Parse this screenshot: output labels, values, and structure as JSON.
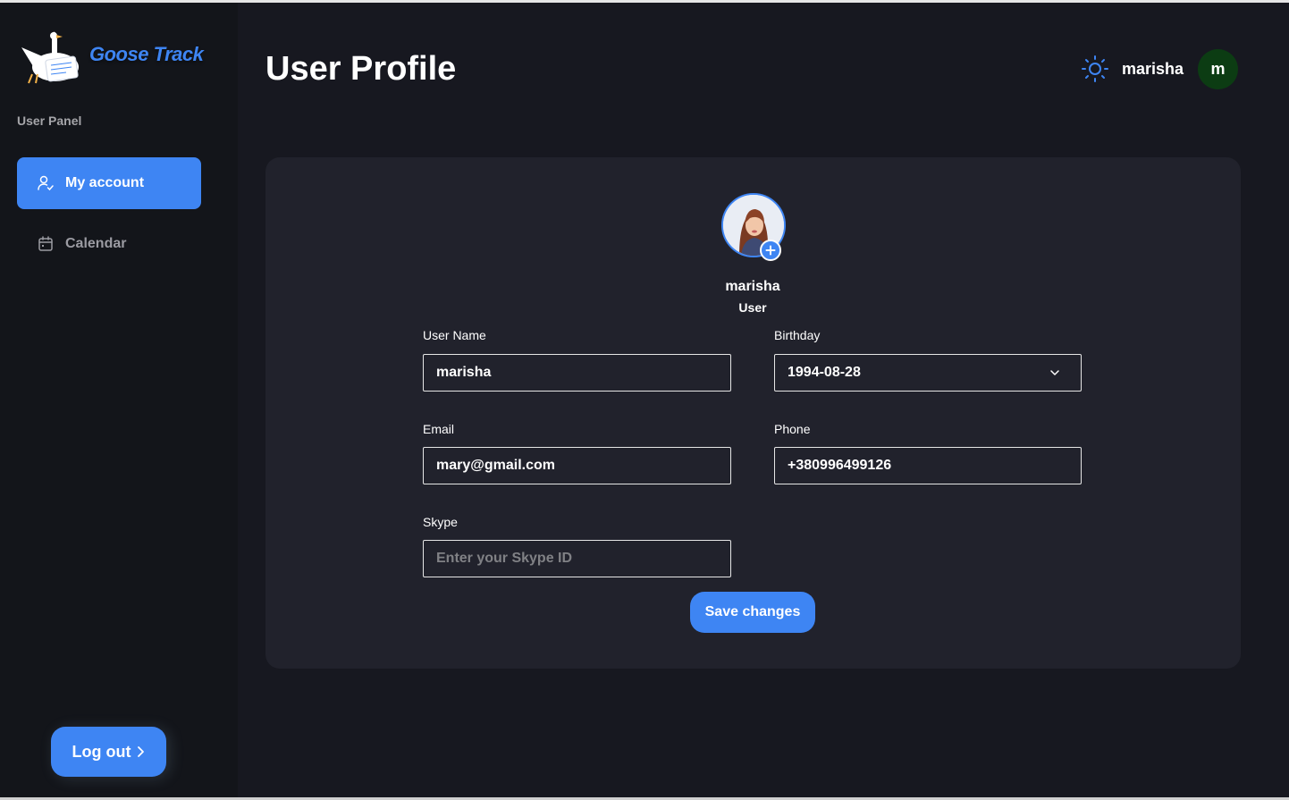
{
  "app": {
    "name": "Goose Track",
    "panel_label": "User Panel"
  },
  "sidebar": {
    "items": [
      {
        "label": "My account",
        "icon": "user-check-icon",
        "active": true
      },
      {
        "label": "Calendar",
        "icon": "calendar-icon",
        "active": false
      }
    ],
    "logout_label": "Log out"
  },
  "header": {
    "title": "User Profile",
    "username": "marisha",
    "avatar_letter": "m",
    "theme_icon": "sun-icon"
  },
  "profile": {
    "name": "marisha",
    "role": "User"
  },
  "form": {
    "username": {
      "label": "User Name",
      "value": "marisha"
    },
    "birthday": {
      "label": "Birthday",
      "value": "1994-08-28"
    },
    "email": {
      "label": "Email",
      "value": "mary@gmail.com"
    },
    "phone": {
      "label": "Phone",
      "value": "+380996499126"
    },
    "skype": {
      "label": "Skype",
      "value": "",
      "placeholder": "Enter your Skype ID"
    },
    "save_label": "Save changes"
  },
  "colors": {
    "accent": "#3e85f3",
    "background": "#171820",
    "sidebar": "#13151a",
    "card": "#21222c",
    "avatar_bg": "#0c3c13"
  }
}
